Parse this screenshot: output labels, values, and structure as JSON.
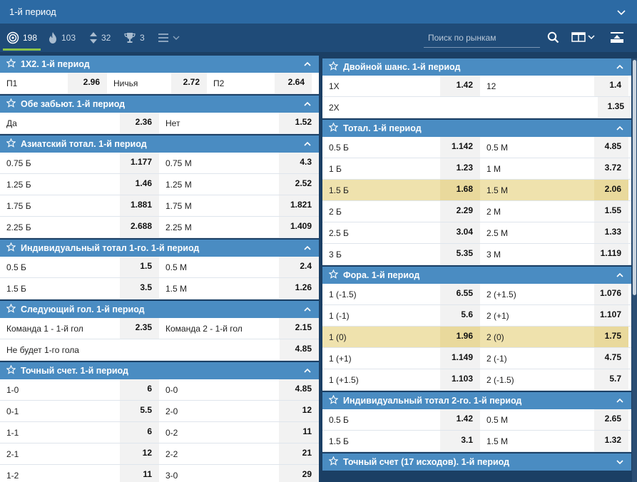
{
  "header": {
    "title": "1-й период"
  },
  "filters": {
    "all": "198",
    "hot": "103",
    "sort": "32",
    "cups": "3"
  },
  "search": {
    "placeholder": "Поиск по рынкам"
  },
  "left": [
    {
      "title": "1Х2. 1-й период",
      "rows": [
        {
          "cells": [
            {
              "l": "П1",
              "o": "2.96"
            },
            {
              "l": "Ничья",
              "o": "2.72"
            },
            {
              "l": "П2",
              "o": "2.64"
            }
          ]
        }
      ]
    },
    {
      "title": "Обе забьют. 1-й период",
      "rows": [
        {
          "cells": [
            {
              "l": "Да",
              "o": "2.36"
            },
            {
              "l": "Нет",
              "o": "1.52"
            }
          ]
        }
      ]
    },
    {
      "title": "Азиатский тотал. 1-й период",
      "rows": [
        {
          "cells": [
            {
              "l": "0.75 Б",
              "o": "1.177"
            },
            {
              "l": "0.75 М",
              "o": "4.3"
            }
          ]
        },
        {
          "cells": [
            {
              "l": "1.25 Б",
              "o": "1.46"
            },
            {
              "l": "1.25 М",
              "o": "2.52"
            }
          ]
        },
        {
          "cells": [
            {
              "l": "1.75 Б",
              "o": "1.881"
            },
            {
              "l": "1.75 М",
              "o": "1.821"
            }
          ]
        },
        {
          "cells": [
            {
              "l": "2.25 Б",
              "o": "2.688"
            },
            {
              "l": "2.25 М",
              "o": "1.409"
            }
          ]
        }
      ]
    },
    {
      "title": "Индивидуальный тотал 1-го. 1-й период",
      "rows": [
        {
          "cells": [
            {
              "l": "0.5 Б",
              "o": "1.5"
            },
            {
              "l": "0.5 М",
              "o": "2.4"
            }
          ]
        },
        {
          "cells": [
            {
              "l": "1.5 Б",
              "o": "3.5"
            },
            {
              "l": "1.5 М",
              "o": "1.26"
            }
          ]
        }
      ]
    },
    {
      "title": "Следующий гол. 1-й период",
      "rows": [
        {
          "cells": [
            {
              "l": "Команда 1 - 1-й гол",
              "o": "2.35"
            },
            {
              "l": "Команда 2 - 1-й гол",
              "o": "2.15"
            }
          ]
        },
        {
          "cells": [
            {
              "l": "Не будет 1-го гола",
              "o": "4.85"
            }
          ]
        }
      ]
    },
    {
      "title": "Точный счет. 1-й период",
      "rows": [
        {
          "cells": [
            {
              "l": "1-0",
              "o": "6"
            },
            {
              "l": "0-0",
              "o": "4.85"
            }
          ]
        },
        {
          "cells": [
            {
              "l": "0-1",
              "o": "5.5"
            },
            {
              "l": "2-0",
              "o": "12"
            }
          ]
        },
        {
          "cells": [
            {
              "l": "1-1",
              "o": "6"
            },
            {
              "l": "0-2",
              "o": "11"
            }
          ]
        },
        {
          "cells": [
            {
              "l": "2-1",
              "o": "12"
            },
            {
              "l": "2-2",
              "o": "21"
            }
          ]
        },
        {
          "cells": [
            {
              "l": "1-2",
              "o": "11"
            },
            {
              "l": "3-0",
              "o": "29"
            }
          ]
        }
      ]
    }
  ],
  "right": [
    {
      "title": "Двойной шанс. 1-й период",
      "rows": [
        {
          "cells": [
            {
              "l": "1Х",
              "o": "1.42"
            },
            {
              "l": "12",
              "o": "1.4"
            }
          ]
        },
        {
          "cells": [
            {
              "l": "2Х",
              "o": "1.35"
            }
          ]
        }
      ]
    },
    {
      "title": "Тотал. 1-й период",
      "rows": [
        {
          "cells": [
            {
              "l": "0.5 Б",
              "o": "1.142"
            },
            {
              "l": "0.5 М",
              "o": "4.85"
            }
          ]
        },
        {
          "cells": [
            {
              "l": "1 Б",
              "o": "1.23"
            },
            {
              "l": "1 М",
              "o": "3.72"
            }
          ]
        },
        {
          "hl": true,
          "cells": [
            {
              "l": "1.5 Б",
              "o": "1.68"
            },
            {
              "l": "1.5 М",
              "o": "2.06"
            }
          ]
        },
        {
          "cells": [
            {
              "l": "2 Б",
              "o": "2.29"
            },
            {
              "l": "2 М",
              "o": "1.55"
            }
          ]
        },
        {
          "cells": [
            {
              "l": "2.5 Б",
              "o": "3.04"
            },
            {
              "l": "2.5 М",
              "o": "1.33"
            }
          ]
        },
        {
          "cells": [
            {
              "l": "3 Б",
              "o": "5.35"
            },
            {
              "l": "3 М",
              "o": "1.119"
            }
          ]
        }
      ]
    },
    {
      "title": "Фора. 1-й период",
      "rows": [
        {
          "cells": [
            {
              "l": "1 (-1.5)",
              "o": "6.55"
            },
            {
              "l": "2 (+1.5)",
              "o": "1.076"
            }
          ]
        },
        {
          "cells": [
            {
              "l": "1 (-1)",
              "o": "5.6"
            },
            {
              "l": "2 (+1)",
              "o": "1.107"
            }
          ]
        },
        {
          "hl": true,
          "cells": [
            {
              "l": "1 (0)",
              "o": "1.96"
            },
            {
              "l": "2 (0)",
              "o": "1.75"
            }
          ]
        },
        {
          "cells": [
            {
              "l": "1 (+1)",
              "o": "1.149"
            },
            {
              "l": "2 (-1)",
              "o": "4.75"
            }
          ]
        },
        {
          "cells": [
            {
              "l": "1 (+1.5)",
              "o": "1.103"
            },
            {
              "l": "2 (-1.5)",
              "o": "5.7"
            }
          ]
        }
      ]
    },
    {
      "title": "Индивидуальный тотал 2-го. 1-й период",
      "rows": [
        {
          "cells": [
            {
              "l": "0.5 Б",
              "o": "1.42"
            },
            {
              "l": "0.5 М",
              "o": "2.65"
            }
          ]
        },
        {
          "cells": [
            {
              "l": "1.5 Б",
              "o": "3.1"
            },
            {
              "l": "1.5 М",
              "o": "1.32"
            }
          ]
        }
      ]
    },
    {
      "title": "Точный счет (17 исходов). 1-й период",
      "collapsed": true,
      "rows": []
    }
  ]
}
